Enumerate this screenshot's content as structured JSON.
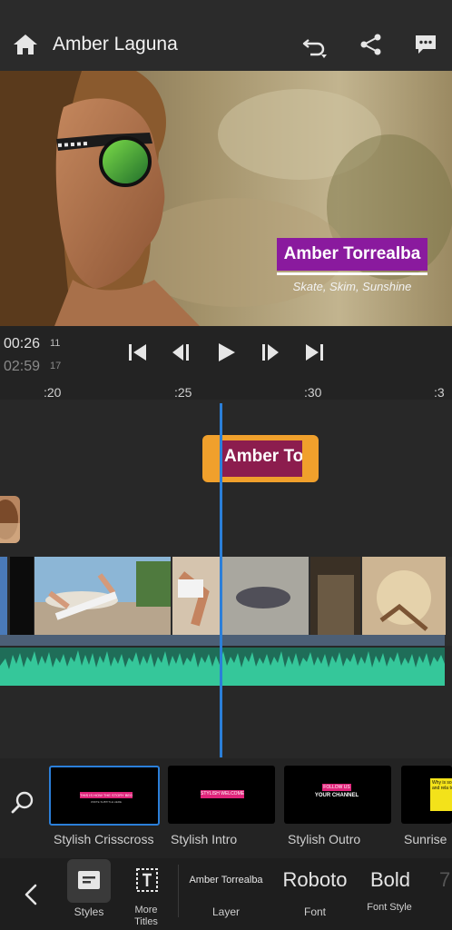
{
  "header": {
    "title": "Amber Laguna"
  },
  "preview": {
    "title_main": "Amber Torrealba",
    "title_sub": "Skate, Skim, Sunshine"
  },
  "transport": {
    "current_time": "00:26",
    "current_frame": "11",
    "total_time": "02:59",
    "total_frame": "17"
  },
  "ruler": {
    "ticks": [
      ":20",
      ":25",
      ":30",
      ":3"
    ]
  },
  "timeline": {
    "title_clip_text": "Amber To"
  },
  "styles": {
    "items": [
      {
        "label": "Stylish Crisscross",
        "selected": true,
        "thumb_text": "THIS IS HOW THE STORY BEGINS",
        "thumb_subtext": "WRITE SUBTITLE HERE"
      },
      {
        "label": "Stylish Intro",
        "selected": false,
        "thumb_text": "STYLISH WELCOME"
      },
      {
        "label": "Stylish Outro",
        "selected": false,
        "thumb_text": "FOLLOW US",
        "thumb_subtext": "YOUR CHANNEL"
      },
      {
        "label": "Sunrise",
        "selected": false,
        "thumb_text": "Why is so far fr and rela to N"
      }
    ]
  },
  "toolbar": {
    "styles_label": "Styles",
    "more_titles_label": "More Titles",
    "layer_value": "Amber Torrealba",
    "layer_label": "Layer",
    "font_value": "Roboto",
    "font_label": "Font",
    "font_style_value": "Bold",
    "font_style_label": "Font Style",
    "next_value": "7"
  },
  "colors": {
    "accent": "#2b7fd9",
    "title_bg": "#8a1a9e",
    "clip_orange": "#f0a02c",
    "audio_green": "#35c79a"
  }
}
